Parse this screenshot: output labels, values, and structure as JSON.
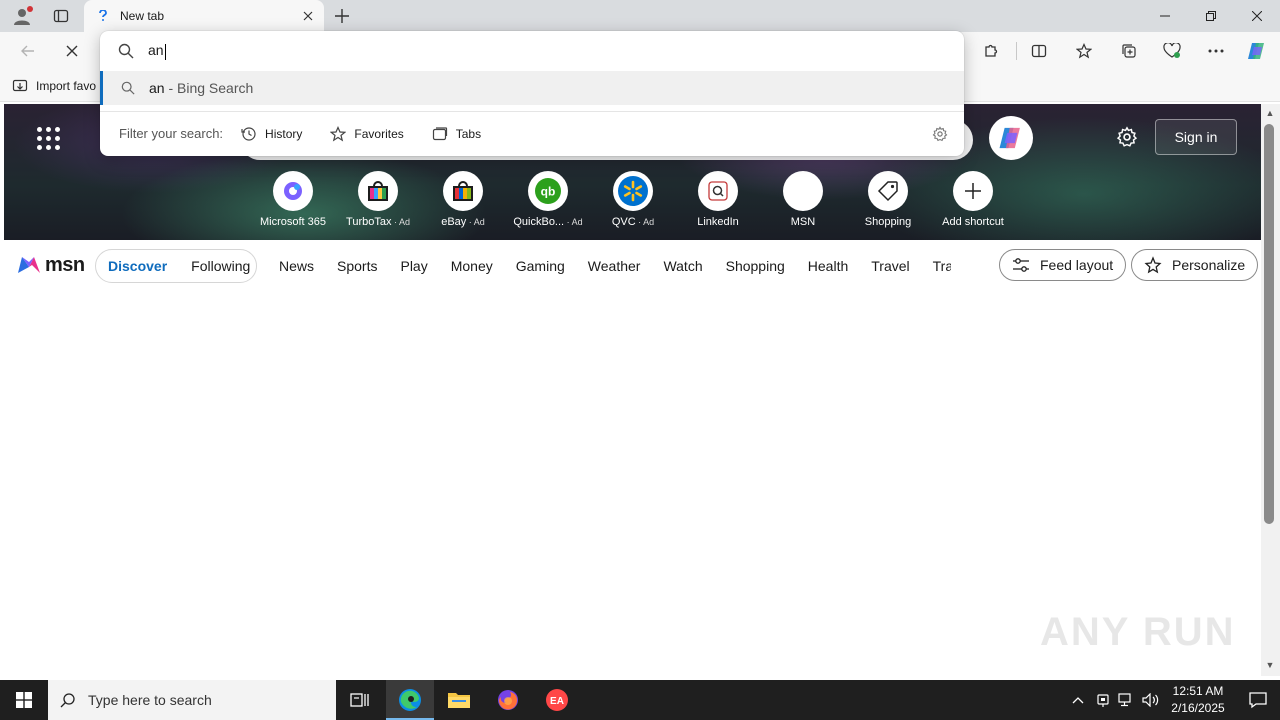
{
  "browser": {
    "tab": {
      "title": "New tab"
    },
    "omnibox": {
      "query": "an",
      "suggestion_main": "an",
      "suggestion_suffix": " - Bing Search",
      "filter_label": "Filter your search:",
      "filters": [
        "History",
        "Favorites",
        "Tabs"
      ]
    },
    "favorites_bar": {
      "import_label": "Import favo"
    }
  },
  "page": {
    "signin_label": "Sign in",
    "shortcuts": [
      {
        "label": "Microsoft 365",
        "ad": "",
        "icon": "m365-icon"
      },
      {
        "label": "TurboTax",
        "ad": " · Ad",
        "icon": "turbotax-icon"
      },
      {
        "label": "eBay",
        "ad": " · Ad",
        "icon": "ebay-icon"
      },
      {
        "label": "QuickBo...",
        "ad": " · Ad",
        "icon": "quickbooks-icon"
      },
      {
        "label": "QVC",
        "ad": " · Ad",
        "icon": "walmart-icon"
      },
      {
        "label": "LinkedIn",
        "ad": "",
        "icon": "linkedin-icon"
      },
      {
        "label": "MSN",
        "ad": "",
        "icon": "msn-icon"
      },
      {
        "label": "Shopping",
        "ad": "",
        "icon": "shopping-tag-icon"
      },
      {
        "label": "Add shortcut",
        "ad": "",
        "icon": "plus-icon"
      }
    ],
    "msn": {
      "logo": "msn",
      "pills": [
        "Discover",
        "Following"
      ],
      "nav": [
        "News",
        "Sports",
        "Play",
        "Money",
        "Gaming",
        "Weather",
        "Watch",
        "Shopping",
        "Health",
        "Travel",
        "Tra"
      ],
      "feed_layout_label": "Feed layout",
      "personalize_label": "Personalize"
    }
  },
  "watermark": "ANY RUN",
  "taskbar": {
    "search_placeholder": "Type here to search",
    "time": "12:51 AM",
    "date": "2/16/2025"
  },
  "colors": {
    "accent": "#0f6cbd",
    "taskbar": "#1f1f1f",
    "chrome": "#d9dcdf"
  }
}
